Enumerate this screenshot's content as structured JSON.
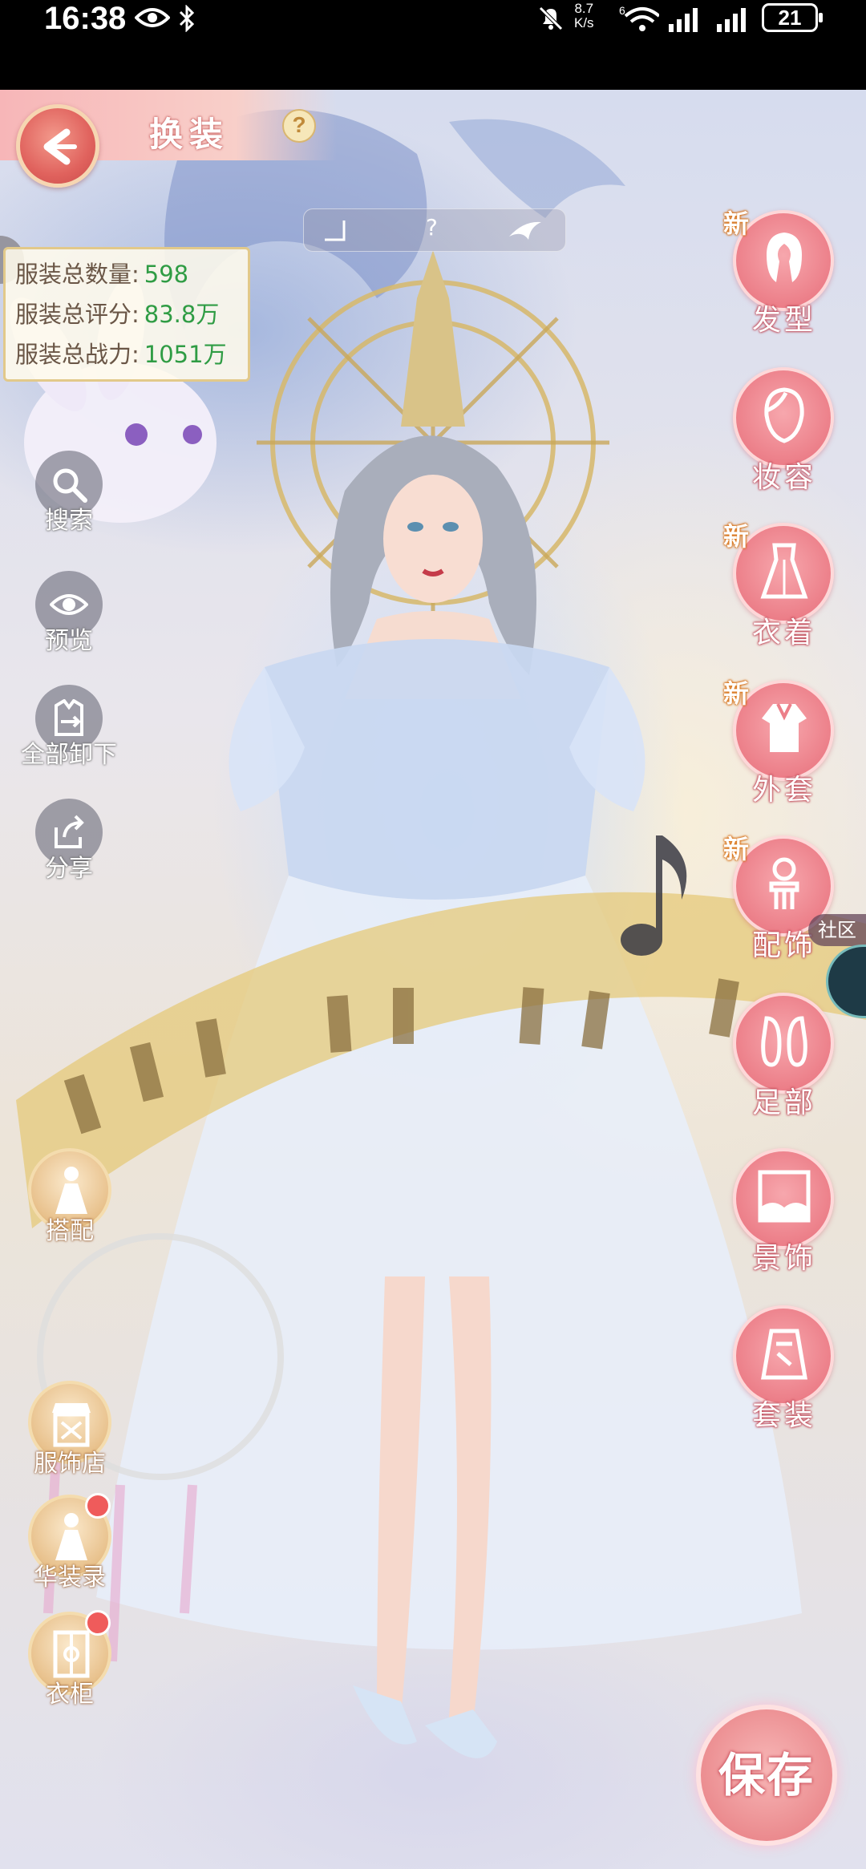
{
  "status_bar": {
    "time": "16:38",
    "net_speed_value": "8.7",
    "net_speed_unit": "K/s",
    "wifi_badge": "6",
    "battery": "21"
  },
  "header": {
    "title": "换装",
    "help": "?"
  },
  "top_banner": {
    "text": "?"
  },
  "stats": [
    {
      "label": "服装总数量:",
      "value": "598"
    },
    {
      "label": "服装总评分:",
      "value": "83.8万"
    },
    {
      "label": "服装总战力:",
      "value": "1051万"
    }
  ],
  "tools": {
    "search": "搜索",
    "preview": "预览",
    "unequip_all": "全部卸下",
    "share": "分享"
  },
  "left_menu": {
    "match": "搭配",
    "shop": "服饰店",
    "collection": "华装录",
    "wardrobe": "衣柜"
  },
  "categories": [
    {
      "label": "发型",
      "new": "新"
    },
    {
      "label": "妆容",
      "new": ""
    },
    {
      "label": "衣着",
      "new": "新"
    },
    {
      "label": "外套",
      "new": "新"
    },
    {
      "label": "配饰",
      "new": "新"
    },
    {
      "label": "足部",
      "new": ""
    },
    {
      "label": "景饰",
      "new": ""
    },
    {
      "label": "套装",
      "new": ""
    }
  ],
  "community": "社区",
  "save": "保存",
  "colors": {
    "accent_pink": "#ec7f89",
    "stat_value_green": "#2f9c44",
    "new_tag_orange": "#e07a1a"
  }
}
